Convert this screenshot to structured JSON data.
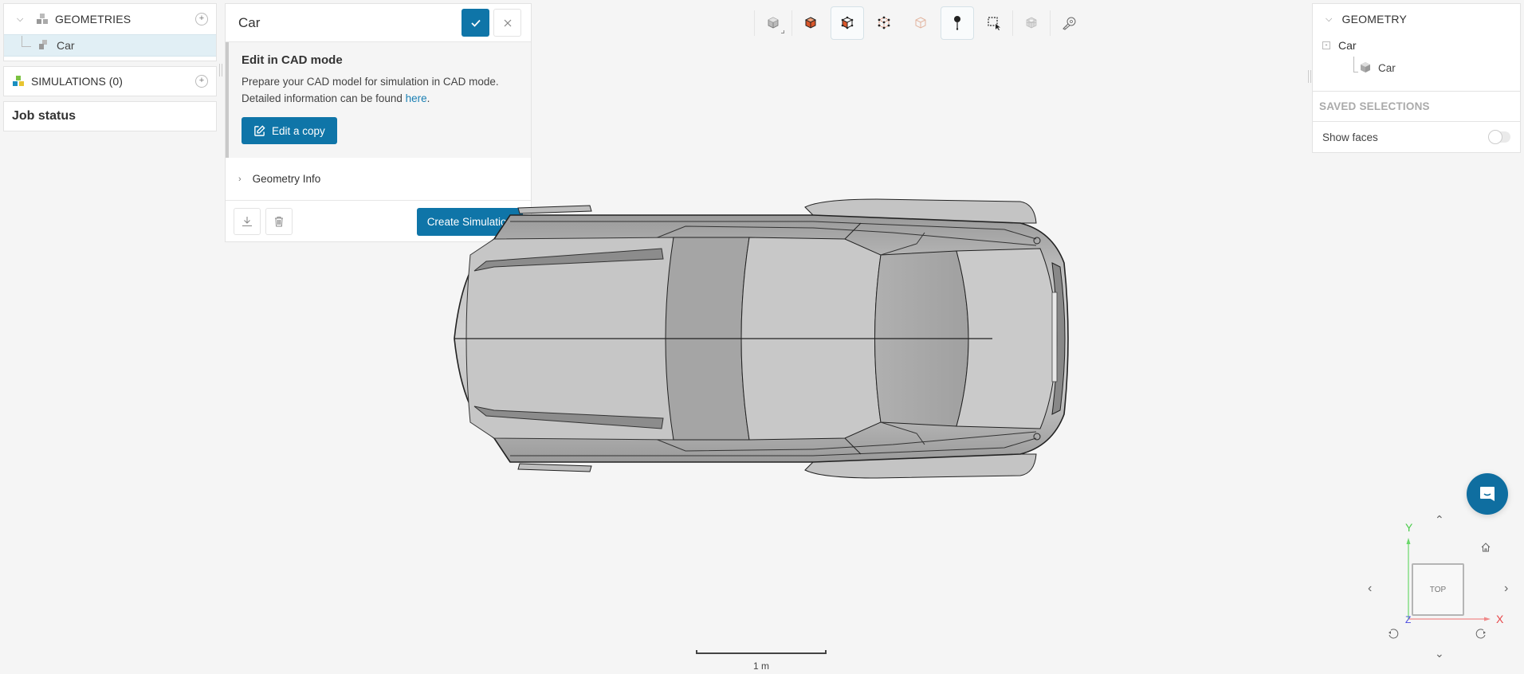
{
  "left_panel": {
    "geometries_label": "GEOMETRIES",
    "geometry_items": [
      {
        "label": "Car",
        "selected": true
      }
    ],
    "simulations_label": "SIMULATIONS (0)",
    "job_status_label": "Job status"
  },
  "dialog": {
    "title": "Car",
    "cad_title": "Edit in CAD mode",
    "cad_text_1": "Prepare your CAD model for simulation in CAD mode.",
    "cad_text_2": "Detailed information can be found ",
    "cad_link": "here",
    "cad_period": ".",
    "edit_copy_label": "Edit a copy",
    "geometry_info_label": "Geometry Info",
    "create_simulation_label": "Create Simulation"
  },
  "toolbar": {
    "buttons": [
      {
        "name": "solid-view",
        "icon": "grey-cube-icon",
        "active": false
      },
      {
        "name": "solid-with-edges",
        "icon": "orange-cube-icon",
        "active": false
      },
      {
        "name": "select-face",
        "icon": "face-select-cube-icon",
        "active": true
      },
      {
        "name": "select-vertex",
        "icon": "vertex-cube-icon",
        "active": false
      },
      {
        "name": "select-volume",
        "icon": "outline-cube-icon",
        "active": false
      },
      {
        "name": "point-marker",
        "icon": "pin-icon",
        "active": true
      },
      {
        "name": "box-select",
        "icon": "box-select-icon",
        "active": false
      },
      {
        "name": "mesh-view",
        "icon": "mesh-cube-icon",
        "active": false
      },
      {
        "name": "measure",
        "icon": "tape-measure-icon",
        "active": false
      }
    ]
  },
  "right_panel": {
    "geometry_label": "GEOMETRY",
    "root_node": "Car",
    "child_node": "Car",
    "saved_selections_label": "SAVED SELECTIONS",
    "show_faces_label": "Show faces",
    "show_faces_enabled": false
  },
  "view_cube": {
    "face_label": "TOP",
    "axis_x": "X",
    "axis_y": "Y",
    "axis_z": "Z"
  },
  "scale_bar": {
    "label": "1 m"
  },
  "colors": {
    "primary": "#0f75a8",
    "selected_row": "#e1eff5",
    "axis_x": "#e8474a",
    "axis_y": "#4ccc4c",
    "axis_z": "#4a4ae0",
    "accent_orange": "#d9562a"
  }
}
